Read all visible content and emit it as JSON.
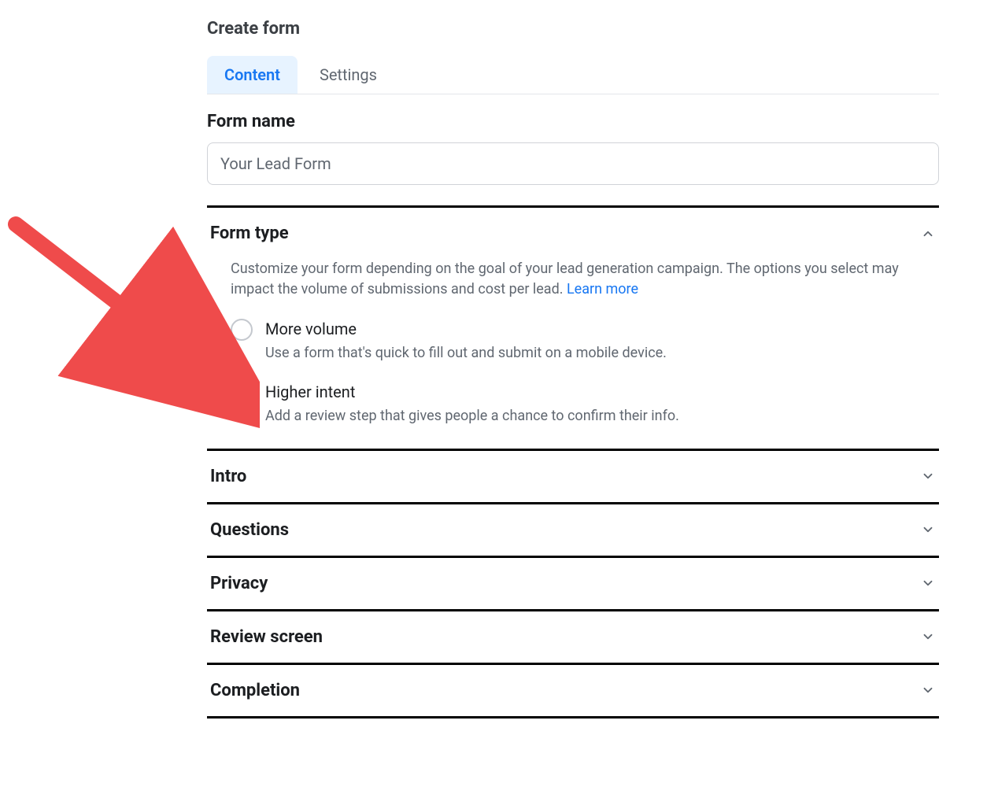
{
  "page_title": "Create form",
  "tabs": {
    "content": "Content",
    "settings": "Settings"
  },
  "form_name": {
    "label": "Form name",
    "value": "Your Lead Form"
  },
  "form_type": {
    "title": "Form type",
    "description_pre": "Customize your form depending on the goal of your lead generation campaign. The options you select may impact the volume of submissions and cost per lead. ",
    "learn_more": "Learn more",
    "options": {
      "more_volume": {
        "label": "More volume",
        "description": "Use a form that's quick to fill out and submit on a mobile device."
      },
      "higher_intent": {
        "label": "Higher intent",
        "description": "Add a review step that gives people a chance to confirm their info."
      }
    }
  },
  "sections": {
    "intro": "Intro",
    "questions": "Questions",
    "privacy": "Privacy",
    "review_screen": "Review screen",
    "completion": "Completion"
  }
}
